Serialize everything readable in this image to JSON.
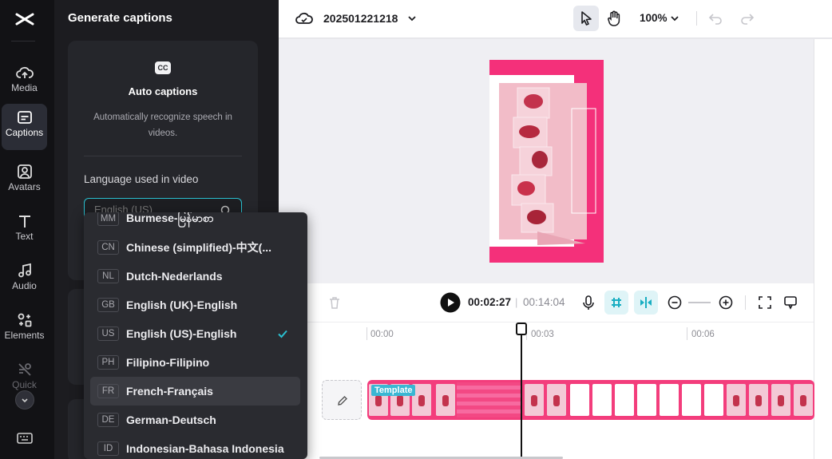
{
  "rail": {
    "items": [
      {
        "label": "Media",
        "icon": "cloud-upload-icon"
      },
      {
        "label": "Captions",
        "icon": "captions-icon",
        "active": true
      },
      {
        "label": "Avatars",
        "icon": "avatar-icon"
      },
      {
        "label": "Text",
        "icon": "text-icon"
      },
      {
        "label": "Audio",
        "icon": "music-note-icon"
      },
      {
        "label": "Elements",
        "icon": "elements-icon"
      },
      {
        "label": "Quick",
        "icon": "quick-cut-icon"
      }
    ]
  },
  "panel": {
    "title": "Generate captions",
    "auto_title": "Auto captions",
    "auto_desc": "Automatically recognize speech in videos.",
    "lang_label": "Language used in video",
    "lang_placeholder": "English (US)"
  },
  "dropdown": {
    "options": [
      {
        "code": "MM",
        "name": "Burmese-မြန်မာစာ"
      },
      {
        "code": "CN",
        "name": "Chinese (simplified)-中文(..."
      },
      {
        "code": "NL",
        "name": "Dutch-Nederlands"
      },
      {
        "code": "GB",
        "name": "English (UK)-English"
      },
      {
        "code": "US",
        "name": "English (US)-English",
        "selected": true
      },
      {
        "code": "PH",
        "name": "Filipino-Filipino"
      },
      {
        "code": "FR",
        "name": "French-Français",
        "hover": true
      },
      {
        "code": "DE",
        "name": "German-Deutsch"
      },
      {
        "code": "ID",
        "name": "Indonesian-Bahasa Indonesia"
      }
    ]
  },
  "topbar": {
    "project_name": "202501221218",
    "zoom": "100%"
  },
  "timeline": {
    "current_time": "00:02:27",
    "separator": "|",
    "total_time": "00:14:04",
    "ruler": [
      "00:00",
      "00:03",
      "00:06"
    ],
    "template_badge": "Template"
  },
  "colors": {
    "accent": "#2ac0d0",
    "brand_pink": "#f33d7c",
    "check": "#2ac0d0"
  }
}
